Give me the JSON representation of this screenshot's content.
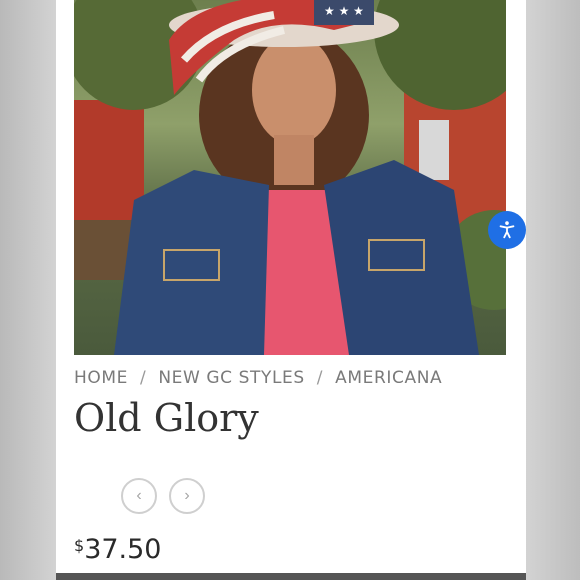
{
  "breadcrumb": {
    "items": [
      "HOME",
      "NEW GC STYLES",
      "AMERICANA"
    ],
    "separator": "/"
  },
  "product": {
    "title": "Old Glory",
    "price_currency": "$",
    "price_amount": "37.50",
    "image_subject": "woman-in-flag-cowboy-hat-and-denim-jacket"
  },
  "nav": {
    "prev_icon": "chevron-left",
    "next_icon": "chevron-right",
    "prev_glyph": "‹",
    "next_glyph": "›"
  },
  "accessibility": {
    "icon": "accessibility-person",
    "color": "#1f6fe5"
  }
}
